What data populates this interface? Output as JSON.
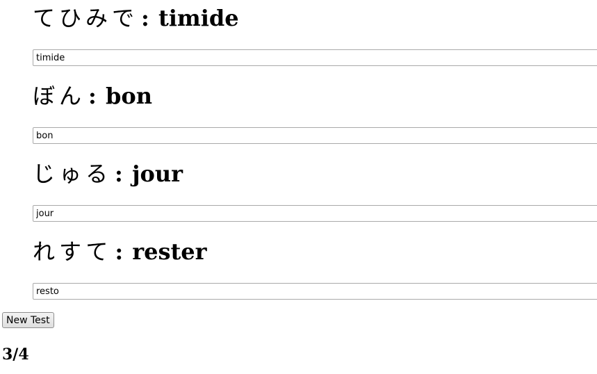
{
  "quiz": {
    "items": [
      {
        "kana": "てひみで",
        "word": "timide",
        "answer": "timide"
      },
      {
        "kana": "ぼん",
        "word": "bon",
        "answer": "bon"
      },
      {
        "kana": "じゅる",
        "word": "jour",
        "answer": "jour"
      },
      {
        "kana": "れすて",
        "word": "rester",
        "answer": "resto"
      }
    ],
    "separator": ":"
  },
  "controls": {
    "new_test_label": "New Test"
  },
  "result": {
    "score": "3/4"
  }
}
